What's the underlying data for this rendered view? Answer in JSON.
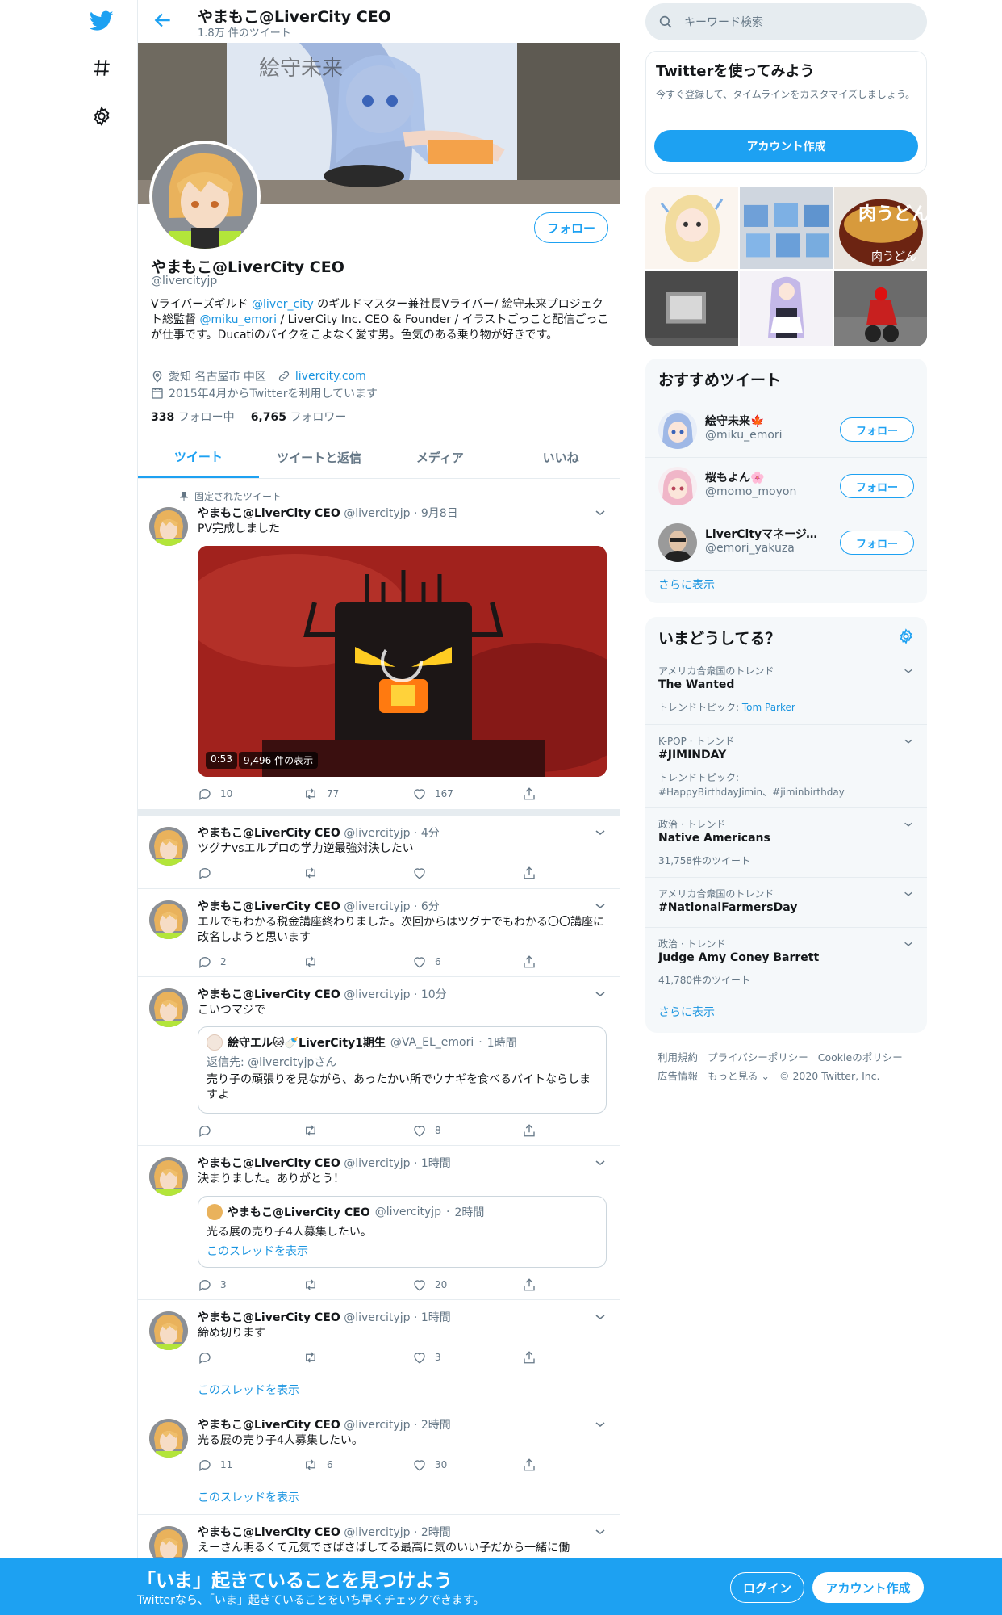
{
  "header": {
    "name": "やまもこ@LiverCity CEO",
    "tweet_count": "1.8万 件のツイート"
  },
  "profile": {
    "name": "やまもこ@LiverCity CEO",
    "handle": "@livercityjp",
    "follow_label": "フォロー",
    "bio_1": "Vライバーズギルド ",
    "bio_mention_1": "@liver_city",
    "bio_2": " のギルドマスター兼社長Vライバー/ 絵守未来プロジェクト総監督 ",
    "bio_mention_2": "@miku_emori",
    "bio_3": " / LiverCity Inc. CEO & Founder / イラストごっこと配信ごっこが仕事です。Ducatiのバイクをこよなく愛す男。色気のある乗り物が好きです。",
    "location": "愛知 名古屋市 中区",
    "website": "livercity.com",
    "joined": "2015年4月からTwitterを利用しています",
    "following_count": "338",
    "following_label": "フォロー中",
    "followers_count": "6,765",
    "followers_label": "フォロワー"
  },
  "tabs": [
    "ツイート",
    "ツイートと返信",
    "メディア",
    "いいね"
  ],
  "pinned_label": "固定されたツイート",
  "tweets": [
    {
      "name": "やまもこ@LiverCity CEO",
      "handle": "@livercityjp",
      "time": "9月8日",
      "text": "PV完成しました",
      "video_duration": "0:53",
      "video_views": "9,496 件の表示",
      "replies": "10",
      "retweets": "77",
      "likes": "167"
    },
    {
      "name": "やまもこ@LiverCity CEO",
      "handle": "@livercityjp",
      "time": "4分",
      "text": "ツグナvsエルプロの学力逆最強対決したい",
      "replies": "",
      "retweets": "",
      "likes": ""
    },
    {
      "name": "やまもこ@LiverCity CEO",
      "handle": "@livercityjp",
      "time": "6分",
      "text": "エルでもわかる税金講座終わりました。次回からはツグナでもわかる〇〇講座に改名しようと思います",
      "replies": "2",
      "retweets": "",
      "likes": "6"
    },
    {
      "name": "やまもこ@LiverCity CEO",
      "handle": "@livercityjp",
      "time": "10分",
      "text": "こいつマジで",
      "quote_name": "絵守エル🐱🍼LiverCity1期生",
      "quote_handle": "@VA_EL_emori",
      "quote_time": "1時間",
      "quote_reply": "返信先: @livercityjpさん",
      "quote_text": "売り子の頑張りを見ながら、あったかい所でウナギを食べるバイトならしますよ",
      "replies": "",
      "retweets": "",
      "likes": "8"
    },
    {
      "name": "やまもこ@LiverCity CEO",
      "handle": "@livercityjp",
      "time": "1時間",
      "text": "決まりました。ありがとう！",
      "quote_name": "やまもこ@LiverCity CEO",
      "quote_handle": "@livercityjp",
      "quote_time": "2時間",
      "quote_text": "光る展の売り子4人募集したい。",
      "quote_more": "このスレッドを表示",
      "replies": "3",
      "retweets": "",
      "likes": "20"
    },
    {
      "name": "やまもこ@LiverCity CEO",
      "handle": "@livercityjp",
      "time": "1時間",
      "text": "締め切ります",
      "thread_link": "このスレッドを表示",
      "replies": "",
      "retweets": "",
      "likes": "3"
    },
    {
      "name": "やまもこ@LiverCity CEO",
      "handle": "@livercityjp",
      "time": "2時間",
      "text": "光る展の売り子4人募集したい。",
      "thread_link": "このスレッドを表示",
      "replies": "11",
      "retweets": "6",
      "likes": "30"
    },
    {
      "name": "やまもこ@LiverCity CEO",
      "handle": "@livercityjp",
      "time": "2時間",
      "text": "えーさん明るくて元気でさばさばしてる最高に気のいい子だから一緒に働"
    }
  ],
  "search": {
    "placeholder": "キーワード検索"
  },
  "signup": {
    "title": "Twitterを使ってみよう",
    "desc": "今すぐ登録して、タイムラインをカスタマイズしましょう。",
    "button": "アカウント作成"
  },
  "wtf": {
    "title": "おすすめツイート",
    "users": [
      {
        "name": "絵守未来🍁",
        "handle": "@miku_emori",
        "button": "フォロー"
      },
      {
        "name": "桜もよん🌸",
        "handle": "@momo_moyon",
        "button": "フォロー"
      },
      {
        "name": "LiverCityマネージャ…",
        "handle": "@emori_yakuza",
        "button": "フォロー"
      }
    ],
    "more": "さらに表示"
  },
  "trends": {
    "title": "いまどうしてる？",
    "items": [
      {
        "cat": "アメリカ合衆国のトレンド",
        "name": "The Wanted",
        "sub": "トレンドトピック: ",
        "sub_link": "Tom Parker"
      },
      {
        "cat": "K-POP · トレンド",
        "name": "#JIMINDAY",
        "sub": "トレンドトピック: ",
        "sub_link": "#HappyBirthdayJimin、#jiminbirthday"
      },
      {
        "cat": "政治 · トレンド",
        "name": "Native Americans",
        "sub": "31,758件のツイート"
      },
      {
        "cat": "アメリカ合衆国のトレンド",
        "name": "#NationalFarmersDay"
      },
      {
        "cat": "政治 · トレンド",
        "name": "Judge Amy Coney Barrett",
        "sub": "41,780件のツイート"
      }
    ],
    "more": "さらに表示"
  },
  "footer": {
    "links": [
      "利用規約",
      "プライバシーポリシー",
      "Cookieのポリシー",
      "広告情報",
      "もっと見る ⌄",
      "© 2020 Twitter, Inc."
    ]
  },
  "bottom_banner": {
    "title": "「いま」起きていることを見つけよう",
    "subtitle": "Twitterなら、「いま」起きていることをいち早くチェックできます。",
    "login": "ログイン",
    "signup": "アカウント作成"
  },
  "colors": {
    "accent": "#1da1f2",
    "link": "#1b95e0",
    "muted": "#657786"
  }
}
